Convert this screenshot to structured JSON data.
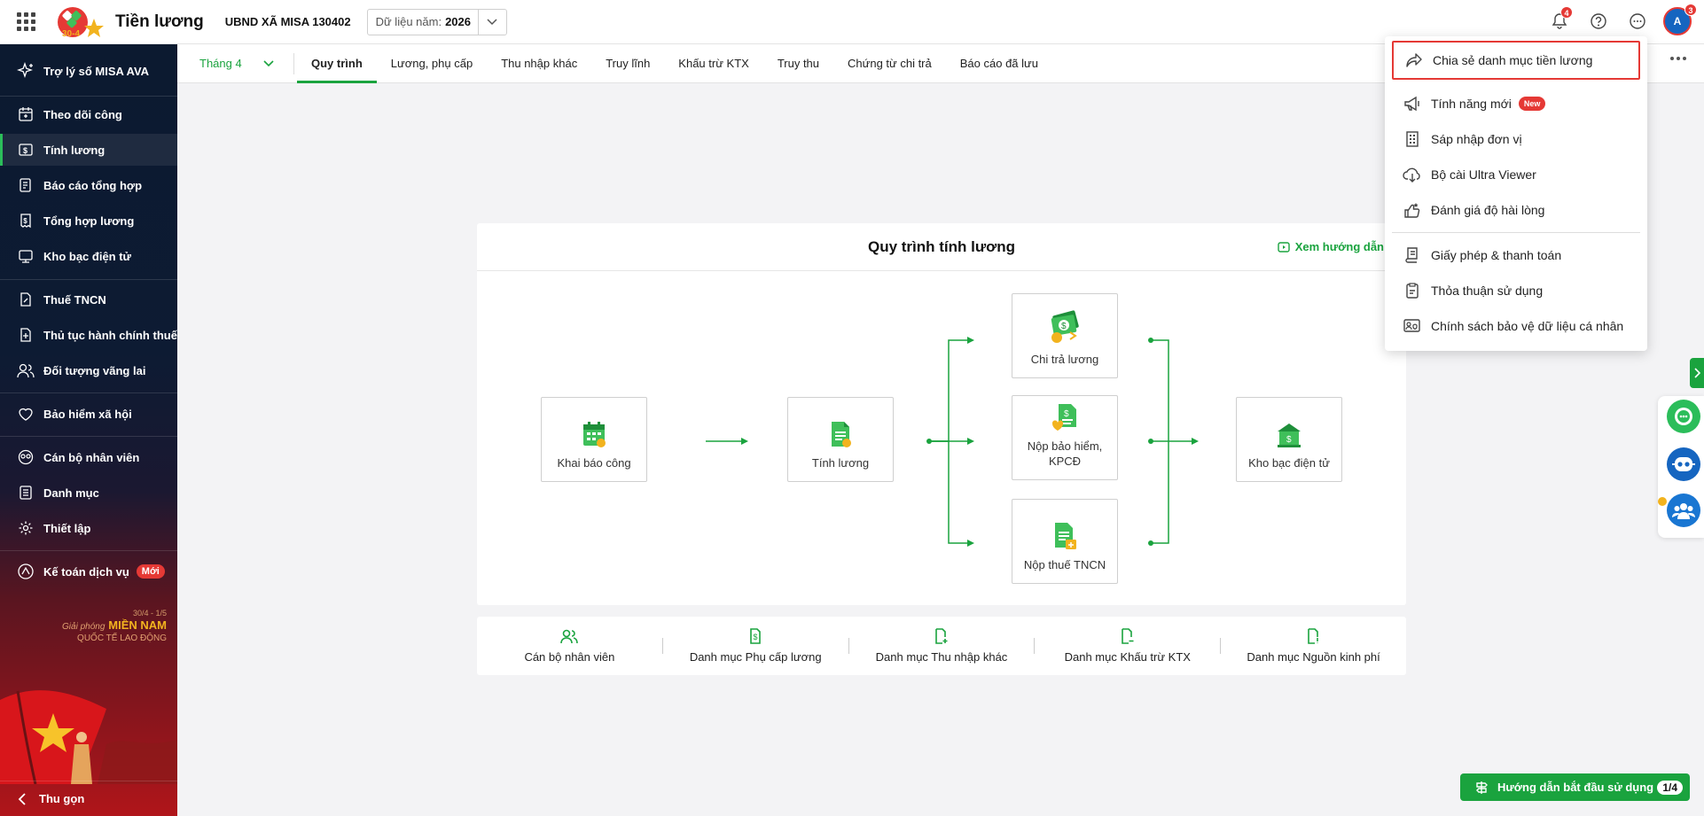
{
  "header": {
    "app_title": "Tiền lương",
    "org_name": "UBND XÃ MISA 130402",
    "year_label": "Dữ liệu năm:",
    "year_value": "2026",
    "notification_count": "4",
    "avatar_initials": "A",
    "avatar_badge": "3",
    "logo_text": "30-4"
  },
  "sidebar": {
    "assistant": "Trợ lý số MISA AVA",
    "items": [
      {
        "label": "Theo dõi công",
        "icon": "calendar-icon"
      },
      {
        "label": "Tính lương",
        "icon": "salary-icon",
        "active": true
      },
      {
        "label": "Báo cáo tổng hợp",
        "icon": "report-icon"
      },
      {
        "label": "Tổng hợp lương",
        "icon": "salary-summary-icon"
      },
      {
        "label": "Kho bạc điện tử",
        "icon": "treasury-icon"
      },
      {
        "label": "Thuế TNCN",
        "icon": "tax-icon"
      },
      {
        "label": "Thủ tục hành chính thuế",
        "icon": "tax-procedure-icon"
      },
      {
        "label": "Đối tượng vãng lai",
        "icon": "visitor-icon"
      },
      {
        "label": "Bảo hiểm xã hội",
        "icon": "insurance-icon"
      },
      {
        "label": "Cán bộ nhân viên",
        "icon": "staff-icon"
      },
      {
        "label": "Danh mục",
        "icon": "catalog-icon"
      },
      {
        "label": "Thiết lập",
        "icon": "settings-icon"
      }
    ],
    "accounting_service": "Kế toán dịch vụ",
    "new_badge": "Mới",
    "promo": {
      "line1": "30/4 - 1/5",
      "line2": "Giải phóng",
      "line3": "MIỀN NAM",
      "line4": "QUỐC TẾ LAO ĐỘNG"
    },
    "collapse": "Thu gọn"
  },
  "tabs": {
    "month": "Tháng 4",
    "items": [
      "Quy trình",
      "Lương, phụ cấp",
      "Thu nhập khác",
      "Truy lĩnh",
      "Khấu trừ KTX",
      "Truy thu",
      "Chứng từ chi trả",
      "Báo cáo đã lưu"
    ],
    "active_index": 0
  },
  "process": {
    "title": "Quy trình tính lương",
    "guide_link": "Xem hướng dẫn",
    "nodes": {
      "attendance": "Khai báo công",
      "calc": "Tính lương",
      "pay": "Chi trả lương",
      "insurance": "Nộp bảo hiểm, KPCĐ",
      "tax": "Nộp thuế TNCN",
      "treasury": "Kho bạc điện tử"
    }
  },
  "shortcuts": [
    {
      "label": "Cán bộ nhân viên",
      "icon": "staff-icon"
    },
    {
      "label": "Danh mục Phụ cấp lương",
      "icon": "allowance-icon"
    },
    {
      "label": "Danh mục Thu nhập khác",
      "icon": "other-income-icon"
    },
    {
      "label": "Danh mục Khấu trừ KTX",
      "icon": "deduction-icon"
    },
    {
      "label": "Danh mục Nguồn kinh phí",
      "icon": "funding-icon"
    }
  ],
  "menu": {
    "items": [
      {
        "label": "Chia sẻ danh mục tiền lương",
        "icon": "share-icon",
        "highlighted": true
      },
      {
        "label": "Tính năng mới",
        "icon": "megaphone-icon",
        "badge": "New"
      },
      {
        "label": "Sáp nhập đơn vị",
        "icon": "building-icon"
      },
      {
        "label": "Bộ cài Ultra Viewer",
        "icon": "cloud-download-icon"
      },
      {
        "label": "Đánh giá độ hài lòng",
        "icon": "rating-icon"
      },
      {
        "label": "Giấy phép & thanh toán",
        "icon": "license-icon"
      },
      {
        "label": "Thỏa thuận sử dụng",
        "icon": "agreement-icon"
      },
      {
        "label": "Chính sách bảo vệ dữ liệu cá nhân",
        "icon": "privacy-icon"
      }
    ]
  },
  "onboarding": {
    "label": "Hướng dẫn bắt đầu sử dụng",
    "progress": "1/4"
  },
  "colors": {
    "accent": "#1aa33e",
    "alert": "#e53935",
    "sidebar": "#0d1b33"
  }
}
